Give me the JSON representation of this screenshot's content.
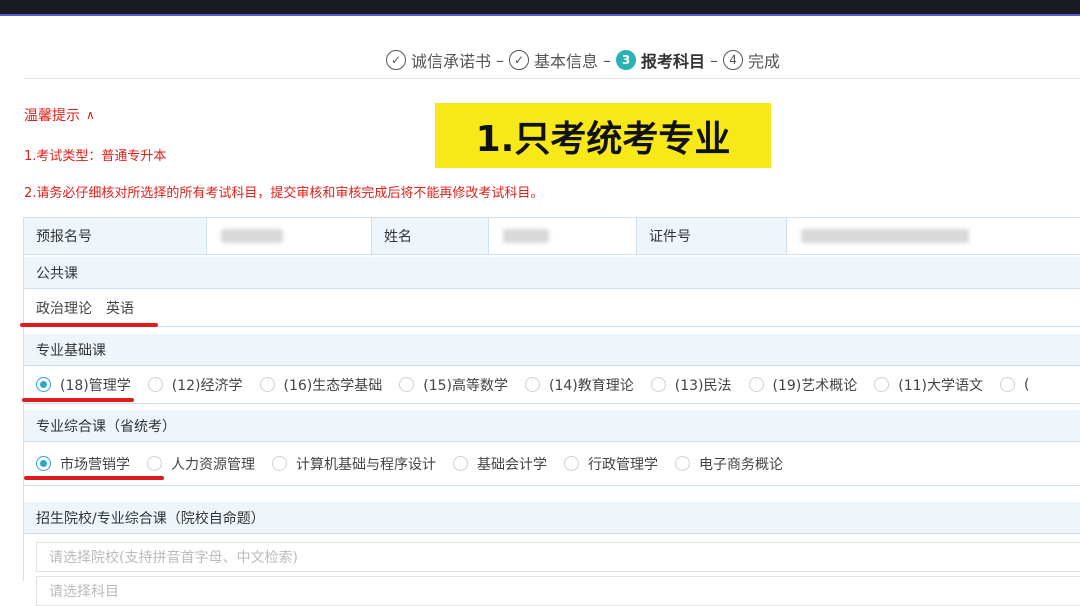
{
  "stepper": {
    "steps": [
      {
        "label": "诚信承诺书",
        "icon": "check-circle-icon",
        "state": "done",
        "marker": "✓"
      },
      {
        "label": "基本信息",
        "icon": "check-circle-icon",
        "state": "done",
        "marker": "✓"
      },
      {
        "label": "报考科目",
        "icon": "number-circle-icon",
        "state": "active",
        "marker": "3"
      },
      {
        "label": "完成",
        "icon": "number-circle-icon",
        "state": "pending",
        "marker": "4"
      }
    ],
    "separator": "–",
    "active_color": "#2bb3b3"
  },
  "banner": {
    "text": "1.只考统考专业",
    "color": "#f7e81a"
  },
  "tips": {
    "title": "温馨提示",
    "lines": [
      "1.考试类型：普通专升本",
      "2.请务必仔细核对所选择的所有考试科目，提交审核和审核完成后将不能再修改考试科目。"
    ],
    "color": "#e0201a"
  },
  "identity": {
    "labels": [
      "预报名号",
      "姓名",
      "证件号"
    ]
  },
  "public_course": {
    "title": "公共课",
    "items": [
      "政治理论",
      "英语"
    ]
  },
  "basic_course": {
    "title": "专业基础课",
    "options": [
      {
        "label": "(18)管理学",
        "selected": true
      },
      {
        "label": "(12)经济学",
        "selected": false
      },
      {
        "label": "(16)生态学基础",
        "selected": false
      },
      {
        "label": "(15)高等数学",
        "selected": false
      },
      {
        "label": "(14)教育理论",
        "selected": false
      },
      {
        "label": "(13)民法",
        "selected": false
      },
      {
        "label": "(19)艺术概论",
        "selected": false
      },
      {
        "label": "(11)大学语文",
        "selected": false
      },
      {
        "label": "(",
        "selected": false
      }
    ]
  },
  "comprehensive_course": {
    "title": "专业综合课（省统考）",
    "options": [
      {
        "label": "市场营销学",
        "selected": true
      },
      {
        "label": "人力资源管理",
        "selected": false
      },
      {
        "label": "计算机基础与程序设计",
        "selected": false
      },
      {
        "label": "基础会计学",
        "selected": false
      },
      {
        "label": "行政管理学",
        "selected": false
      },
      {
        "label": "电子商务概论",
        "selected": false
      }
    ]
  },
  "school_course": {
    "title": "招生院校/专业综合课（院校自命题）",
    "school_placeholder": "请选择院校(支持拼音首字母、中文检索)",
    "subject_placeholder": "请选择科目"
  },
  "colors": {
    "radio_selected": "#2aa5d6",
    "section_header_bg": "#eef6fc",
    "annotation_underline": "#e11b1b"
  }
}
